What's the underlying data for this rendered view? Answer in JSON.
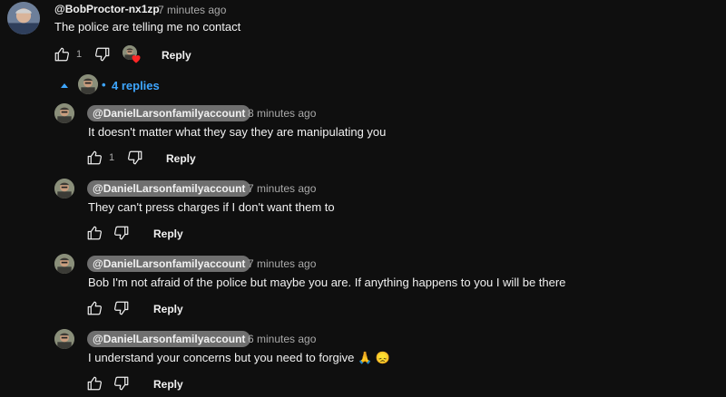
{
  "main_comment": {
    "author": "@BobProctor-nx1zp",
    "time": "7 minutes ago",
    "text": "The police are telling me no contact",
    "like_count": "1",
    "reply_label": "Reply",
    "icons": {
      "like": "thumbs-up-icon",
      "dislike": "thumbs-down-icon",
      "heart": "creator-heart-icon"
    }
  },
  "replies_toggle": {
    "label": "4 replies",
    "icon": "caret-up-icon",
    "accent": "#3ea6ff"
  },
  "replies": [
    {
      "author": "@DanielLarsonfamilyaccount",
      "time": "8 minutes ago",
      "text": "It doesn't matter what they say they are manipulating you",
      "like_count": "1",
      "reply_label": "Reply"
    },
    {
      "author": "@DanielLarsonfamilyaccount",
      "time": "7 minutes ago",
      "text": "They can't press charges if I don't want them to",
      "like_count": "",
      "reply_label": "Reply"
    },
    {
      "author": "@DanielLarsonfamilyaccount",
      "time": "7 minutes ago",
      "text": "Bob I'm not afraid of the police but maybe you are. If anything happens to you I will be there",
      "like_count": "",
      "reply_label": "Reply"
    },
    {
      "author": "@DanielLarsonfamilyaccount",
      "time": "6 minutes ago",
      "text": "I understand your concerns but you need to forgive 🙏 😞",
      "like_count": "",
      "reply_label": "Reply"
    }
  ]
}
